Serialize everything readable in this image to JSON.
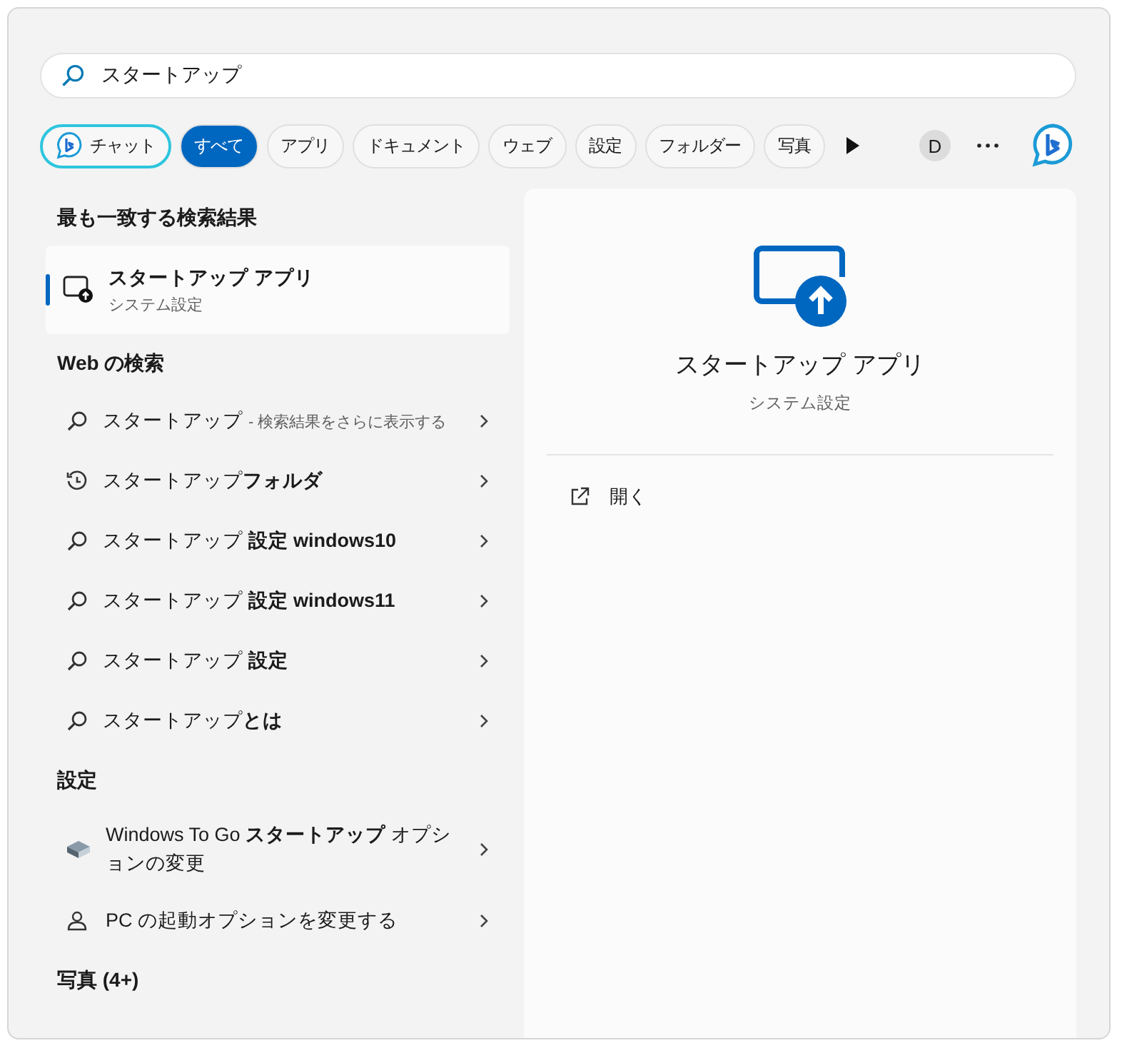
{
  "search": {
    "value": "スタートアップ"
  },
  "filters": [
    {
      "kind": "chat",
      "label": "チャット",
      "selected": false
    },
    {
      "kind": "chip",
      "label": "すべて",
      "selected": true
    },
    {
      "kind": "chip",
      "label": "アプリ",
      "selected": false
    },
    {
      "kind": "chip",
      "label": "ドキュメント",
      "selected": false
    },
    {
      "kind": "chip",
      "label": "ウェブ",
      "selected": false
    },
    {
      "kind": "chip",
      "label": "設定",
      "selected": false
    },
    {
      "kind": "chip",
      "label": "フォルダー",
      "selected": false
    },
    {
      "kind": "chip",
      "label": "写真",
      "selected": false
    }
  ],
  "account": {
    "initial": "D"
  },
  "best_match": {
    "heading": "最も一致する検索結果",
    "title": "スタートアップ アプリ",
    "subtitle": "システム設定",
    "selected": true
  },
  "web": {
    "heading": "Web の検索",
    "items": [
      {
        "kind": "search",
        "text": "スタートアップ",
        "suffix": "- 検索結果をさらに表示する"
      },
      {
        "kind": "history",
        "text": "スタートアップ**フォルダ**"
      },
      {
        "kind": "search",
        "text": "スタートアップ **設定 windows10**"
      },
      {
        "kind": "search",
        "text": "スタートアップ **設定 windows11**"
      },
      {
        "kind": "search",
        "text": "スタートアップ **設定**"
      },
      {
        "kind": "search",
        "text": "スタートアップ**とは**"
      }
    ]
  },
  "settings": {
    "heading": "設定",
    "items": [
      {
        "kind": "drive",
        "text": "Windows To Go **スタートアップ** オプションの変更"
      },
      {
        "kind": "user",
        "text": "PC の起動オプションを変更する"
      }
    ]
  },
  "photos": {
    "heading": "写真 (4+)"
  },
  "preview": {
    "title": "スタートアップ アプリ",
    "subtitle": "システム設定",
    "actions": [
      {
        "label": "開く"
      }
    ]
  }
}
